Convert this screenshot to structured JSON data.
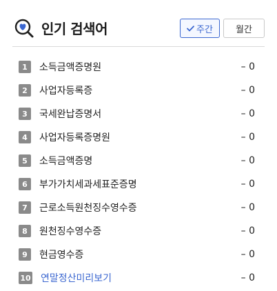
{
  "header": {
    "title": "인기 검색어",
    "title_icon": "magnifier-heart-icon",
    "tabs": [
      {
        "label": "주간",
        "selected": true,
        "icon": "check-icon"
      },
      {
        "label": "월간",
        "selected": false
      }
    ]
  },
  "colors": {
    "accent": "#3a66d0",
    "rank_badge": "#8a8a8a",
    "divider": "#d9d9d9"
  },
  "items": [
    {
      "rank": "1",
      "term": "소득금액증명원",
      "change": "– 0"
    },
    {
      "rank": "2",
      "term": "사업자등록증",
      "change": "– 0"
    },
    {
      "rank": "3",
      "term": "국세완납증명서",
      "change": "– 0"
    },
    {
      "rank": "4",
      "term": "사업자등록증명원",
      "change": "– 0"
    },
    {
      "rank": "5",
      "term": "소득금액증명",
      "change": "– 0"
    },
    {
      "rank": "6",
      "term": "부가가치세과세표준증명",
      "change": "– 0"
    },
    {
      "rank": "7",
      "term": "근로소득원천징수영수증",
      "change": "– 0"
    },
    {
      "rank": "8",
      "term": "원천징수영수증",
      "change": "– 0"
    },
    {
      "rank": "9",
      "term": "현금영수증",
      "change": "– 0"
    },
    {
      "rank": "10",
      "term": "연말정산미리보기",
      "change": "– 0",
      "highlight": true
    }
  ]
}
